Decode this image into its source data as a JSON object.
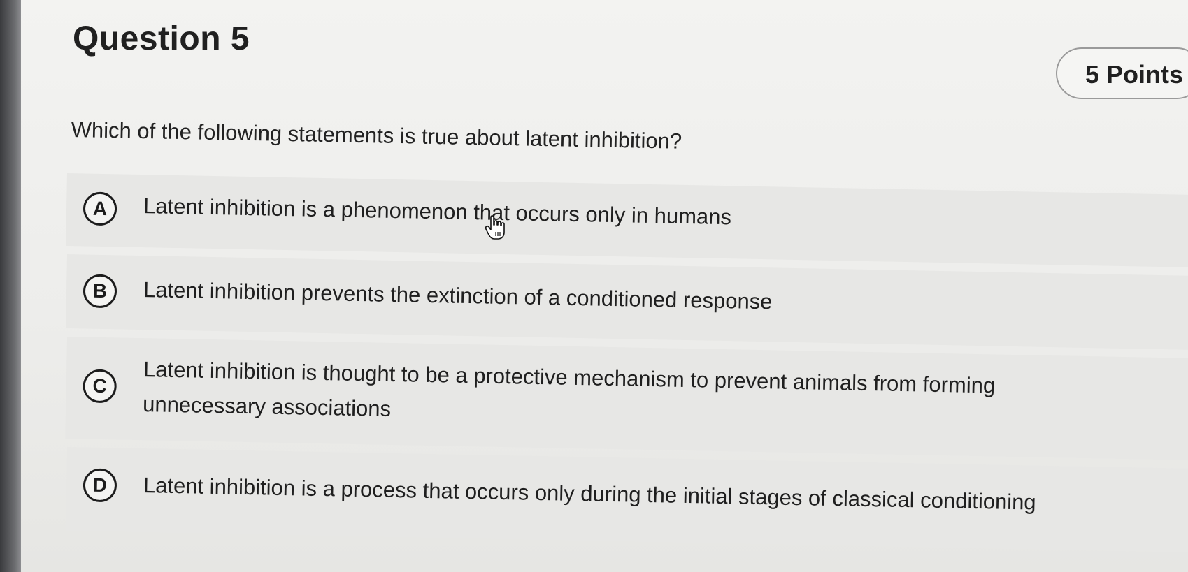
{
  "question": {
    "title": "Question 5",
    "points": "5 Points",
    "prompt": "Which of the following statements is true about latent inhibition?"
  },
  "options": [
    {
      "letter": "A",
      "text_line1": "Latent inhibition is a phenomenon that occurs only in humans",
      "text_line2": ""
    },
    {
      "letter": "B",
      "text_line1": "Latent inhibition prevents the extinction of a conditioned response",
      "text_line2": ""
    },
    {
      "letter": "C",
      "text_line1": "Latent inhibition is thought to be a protective mechanism to prevent animals from forming",
      "text_line2": "unnecessary associations"
    },
    {
      "letter": "D",
      "text_line1": "Latent inhibition is a process that occurs only during the initial stages of classical conditioning",
      "text_line2": ""
    }
  ],
  "cursor": {
    "icon": "hand-pointer-icon"
  },
  "colors": {
    "background": "#efefed",
    "option_background": "#e7e7e5",
    "text": "#1f1f1f",
    "badge_border": "#9a9a9a"
  }
}
